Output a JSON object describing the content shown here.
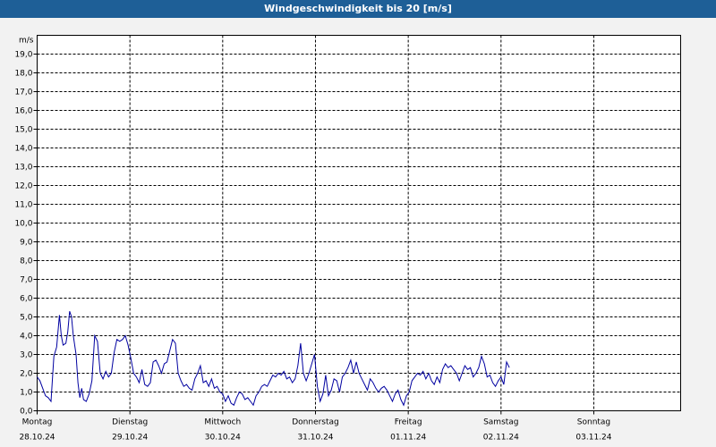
{
  "window": {
    "title": "Windgeschwindigkeit bis 20 [m/s]"
  },
  "chart_data": {
    "type": "line",
    "title": "Windgeschwindigkeit bis 20 [m/s]",
    "ylabel": "m/s",
    "ylim": [
      0,
      20
    ],
    "y_ticks": [
      "0,0",
      "1,0",
      "2,0",
      "3,0",
      "4,0",
      "5,0",
      "6,0",
      "7,0",
      "8,0",
      "9,0",
      "10,0",
      "11,0",
      "12,0",
      "13,0",
      "14,0",
      "15,0",
      "16,0",
      "17,0",
      "18,0",
      "19,0"
    ],
    "xlim": [
      0,
      7
    ],
    "x_ticks": [
      {
        "day": "Montag",
        "date": "28.10.24"
      },
      {
        "day": "Dienstag",
        "date": "29.10.24"
      },
      {
        "day": "Mittwoch",
        "date": "30.10.24"
      },
      {
        "day": "Donnerstag",
        "date": "31.10.24"
      },
      {
        "day": "Freitag",
        "date": "01.11.24"
      },
      {
        "day": "Samstag",
        "date": "02.11.24"
      },
      {
        "day": "Sonntag",
        "date": "03.11.24"
      }
    ],
    "grid": true,
    "line_color": "#0000a0",
    "series": [
      {
        "values": [
          [
            0.0,
            1.8
          ],
          [
            0.03,
            1.6
          ],
          [
            0.06,
            1.2
          ],
          [
            0.09,
            0.8
          ],
          [
            0.12,
            0.7
          ],
          [
            0.15,
            0.5
          ],
          [
            0.18,
            2.9
          ],
          [
            0.21,
            3.4
          ],
          [
            0.24,
            5.1
          ],
          [
            0.26,
            4.0
          ],
          [
            0.28,
            3.5
          ],
          [
            0.31,
            3.6
          ],
          [
            0.33,
            4.2
          ],
          [
            0.35,
            5.3
          ],
          [
            0.37,
            5.0
          ],
          [
            0.39,
            4.0
          ],
          [
            0.42,
            3.0
          ],
          [
            0.44,
            1.5
          ],
          [
            0.46,
            0.7
          ],
          [
            0.48,
            1.2
          ],
          [
            0.5,
            0.6
          ],
          [
            0.53,
            0.5
          ],
          [
            0.56,
            0.9
          ],
          [
            0.59,
            1.6
          ],
          [
            0.62,
            4.0
          ],
          [
            0.65,
            3.7
          ],
          [
            0.68,
            2.0
          ],
          [
            0.71,
            1.7
          ],
          [
            0.74,
            2.1
          ],
          [
            0.77,
            1.8
          ],
          [
            0.8,
            2.0
          ],
          [
            0.83,
            3.1
          ],
          [
            0.86,
            3.8
          ],
          [
            0.89,
            3.7
          ],
          [
            0.92,
            3.8
          ],
          [
            0.95,
            4.0
          ],
          [
            0.98,
            3.5
          ],
          [
            1.01,
            2.8
          ],
          [
            1.04,
            2.0
          ],
          [
            1.07,
            1.8
          ],
          [
            1.1,
            1.5
          ],
          [
            1.13,
            2.2
          ],
          [
            1.16,
            1.4
          ],
          [
            1.19,
            1.3
          ],
          [
            1.22,
            1.5
          ],
          [
            1.25,
            2.6
          ],
          [
            1.28,
            2.7
          ],
          [
            1.31,
            2.4
          ],
          [
            1.34,
            2.0
          ],
          [
            1.37,
            2.5
          ],
          [
            1.4,
            2.6
          ],
          [
            1.43,
            3.2
          ],
          [
            1.46,
            3.8
          ],
          [
            1.49,
            3.6
          ],
          [
            1.52,
            2.0
          ],
          [
            1.55,
            1.6
          ],
          [
            1.58,
            1.3
          ],
          [
            1.61,
            1.4
          ],
          [
            1.64,
            1.2
          ],
          [
            1.67,
            1.1
          ],
          [
            1.7,
            1.7
          ],
          [
            1.73,
            2.0
          ],
          [
            1.76,
            2.4
          ],
          [
            1.79,
            1.5
          ],
          [
            1.82,
            1.6
          ],
          [
            1.85,
            1.3
          ],
          [
            1.88,
            1.7
          ],
          [
            1.91,
            1.2
          ],
          [
            1.94,
            1.3
          ],
          [
            1.97,
            1.0
          ],
          [
            2.0,
            0.9
          ],
          [
            2.03,
            0.5
          ],
          [
            2.06,
            0.8
          ],
          [
            2.09,
            0.4
          ],
          [
            2.12,
            0.3
          ],
          [
            2.15,
            0.7
          ],
          [
            2.18,
            1.0
          ],
          [
            2.21,
            0.9
          ],
          [
            2.24,
            0.6
          ],
          [
            2.27,
            0.7
          ],
          [
            2.3,
            0.5
          ],
          [
            2.33,
            0.3
          ],
          [
            2.36,
            0.8
          ],
          [
            2.39,
            1.0
          ],
          [
            2.42,
            1.3
          ],
          [
            2.45,
            1.4
          ],
          [
            2.48,
            1.3
          ],
          [
            2.51,
            1.6
          ],
          [
            2.54,
            1.9
          ],
          [
            2.57,
            1.8
          ],
          [
            2.6,
            2.0
          ],
          [
            2.63,
            1.9
          ],
          [
            2.66,
            2.1
          ],
          [
            2.69,
            1.7
          ],
          [
            2.72,
            1.8
          ],
          [
            2.75,
            1.5
          ],
          [
            2.78,
            1.7
          ],
          [
            2.81,
            2.4
          ],
          [
            2.84,
            3.6
          ],
          [
            2.87,
            2.0
          ],
          [
            2.9,
            1.6
          ],
          [
            2.93,
            2.0
          ],
          [
            2.96,
            2.5
          ],
          [
            2.99,
            3.0
          ],
          [
            3.02,
            1.3
          ],
          [
            3.05,
            0.5
          ],
          [
            3.08,
            0.9
          ],
          [
            3.11,
            1.9
          ],
          [
            3.14,
            0.8
          ],
          [
            3.17,
            1.1
          ],
          [
            3.2,
            1.7
          ],
          [
            3.23,
            1.6
          ],
          [
            3.26,
            1.0
          ],
          [
            3.29,
            1.8
          ],
          [
            3.32,
            2.0
          ],
          [
            3.35,
            2.3
          ],
          [
            3.38,
            2.7
          ],
          [
            3.41,
            2.0
          ],
          [
            3.44,
            2.6
          ],
          [
            3.47,
            2.0
          ],
          [
            3.5,
            1.7
          ],
          [
            3.53,
            1.4
          ],
          [
            3.56,
            1.1
          ],
          [
            3.59,
            1.7
          ],
          [
            3.62,
            1.5
          ],
          [
            3.65,
            1.2
          ],
          [
            3.68,
            1.0
          ],
          [
            3.71,
            1.2
          ],
          [
            3.74,
            1.3
          ],
          [
            3.77,
            1.1
          ],
          [
            3.8,
            0.8
          ],
          [
            3.83,
            0.5
          ],
          [
            3.86,
            0.9
          ],
          [
            3.89,
            1.1
          ],
          [
            3.92,
            0.6
          ],
          [
            3.95,
            0.3
          ],
          [
            3.98,
            0.8
          ],
          [
            4.01,
            1.0
          ],
          [
            4.04,
            1.6
          ],
          [
            4.07,
            1.8
          ],
          [
            4.1,
            2.0
          ],
          [
            4.13,
            1.9
          ],
          [
            4.16,
            2.1
          ],
          [
            4.19,
            1.7
          ],
          [
            4.22,
            2.0
          ],
          [
            4.25,
            1.6
          ],
          [
            4.28,
            1.4
          ],
          [
            4.31,
            1.8
          ],
          [
            4.34,
            1.5
          ],
          [
            4.37,
            2.2
          ],
          [
            4.4,
            2.5
          ],
          [
            4.43,
            2.3
          ],
          [
            4.46,
            2.4
          ],
          [
            4.49,
            2.2
          ],
          [
            4.52,
            2.0
          ],
          [
            4.55,
            1.6
          ],
          [
            4.58,
            2.0
          ],
          [
            4.61,
            2.4
          ],
          [
            4.64,
            2.2
          ],
          [
            4.67,
            2.3
          ],
          [
            4.7,
            1.8
          ],
          [
            4.73,
            2.0
          ],
          [
            4.76,
            2.3
          ],
          [
            4.79,
            2.9
          ],
          [
            4.82,
            2.5
          ],
          [
            4.85,
            1.8
          ],
          [
            4.88,
            1.9
          ],
          [
            4.91,
            1.5
          ],
          [
            4.94,
            1.3
          ],
          [
            4.97,
            1.6
          ],
          [
            5.0,
            1.8
          ],
          [
            5.03,
            1.4
          ],
          [
            5.06,
            2.6
          ],
          [
            5.09,
            2.3
          ]
        ]
      }
    ]
  }
}
